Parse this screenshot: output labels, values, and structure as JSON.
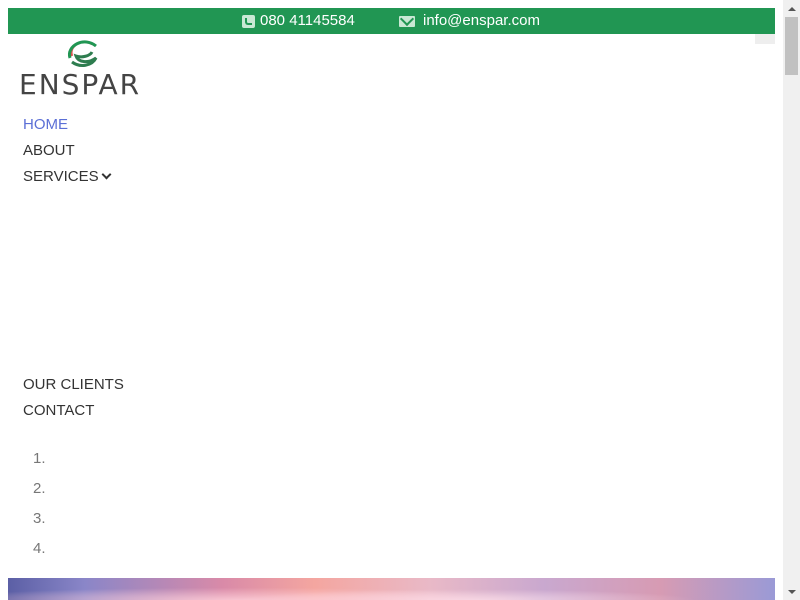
{
  "topbar": {
    "phone": "080 41145584",
    "phone_icon": "phone-icon",
    "email": "info@enspar.com",
    "email_icon": "envelope-icon",
    "background_color": "#219653"
  },
  "logo": {
    "text": "ENSPAR",
    "icon": "enspar-swirl-logo"
  },
  "nav": {
    "items": [
      {
        "label": "HOME",
        "active": true
      },
      {
        "label": "ABOUT"
      },
      {
        "label": "SERVICES",
        "has_dropdown": true
      },
      {
        "label": "OUR CLIENTS"
      },
      {
        "label": "CONTACT"
      }
    ],
    "active_color": "#5b6fd6"
  },
  "ordered_list": {
    "numbers": [
      "1.",
      "2.",
      "3.",
      "4."
    ]
  }
}
